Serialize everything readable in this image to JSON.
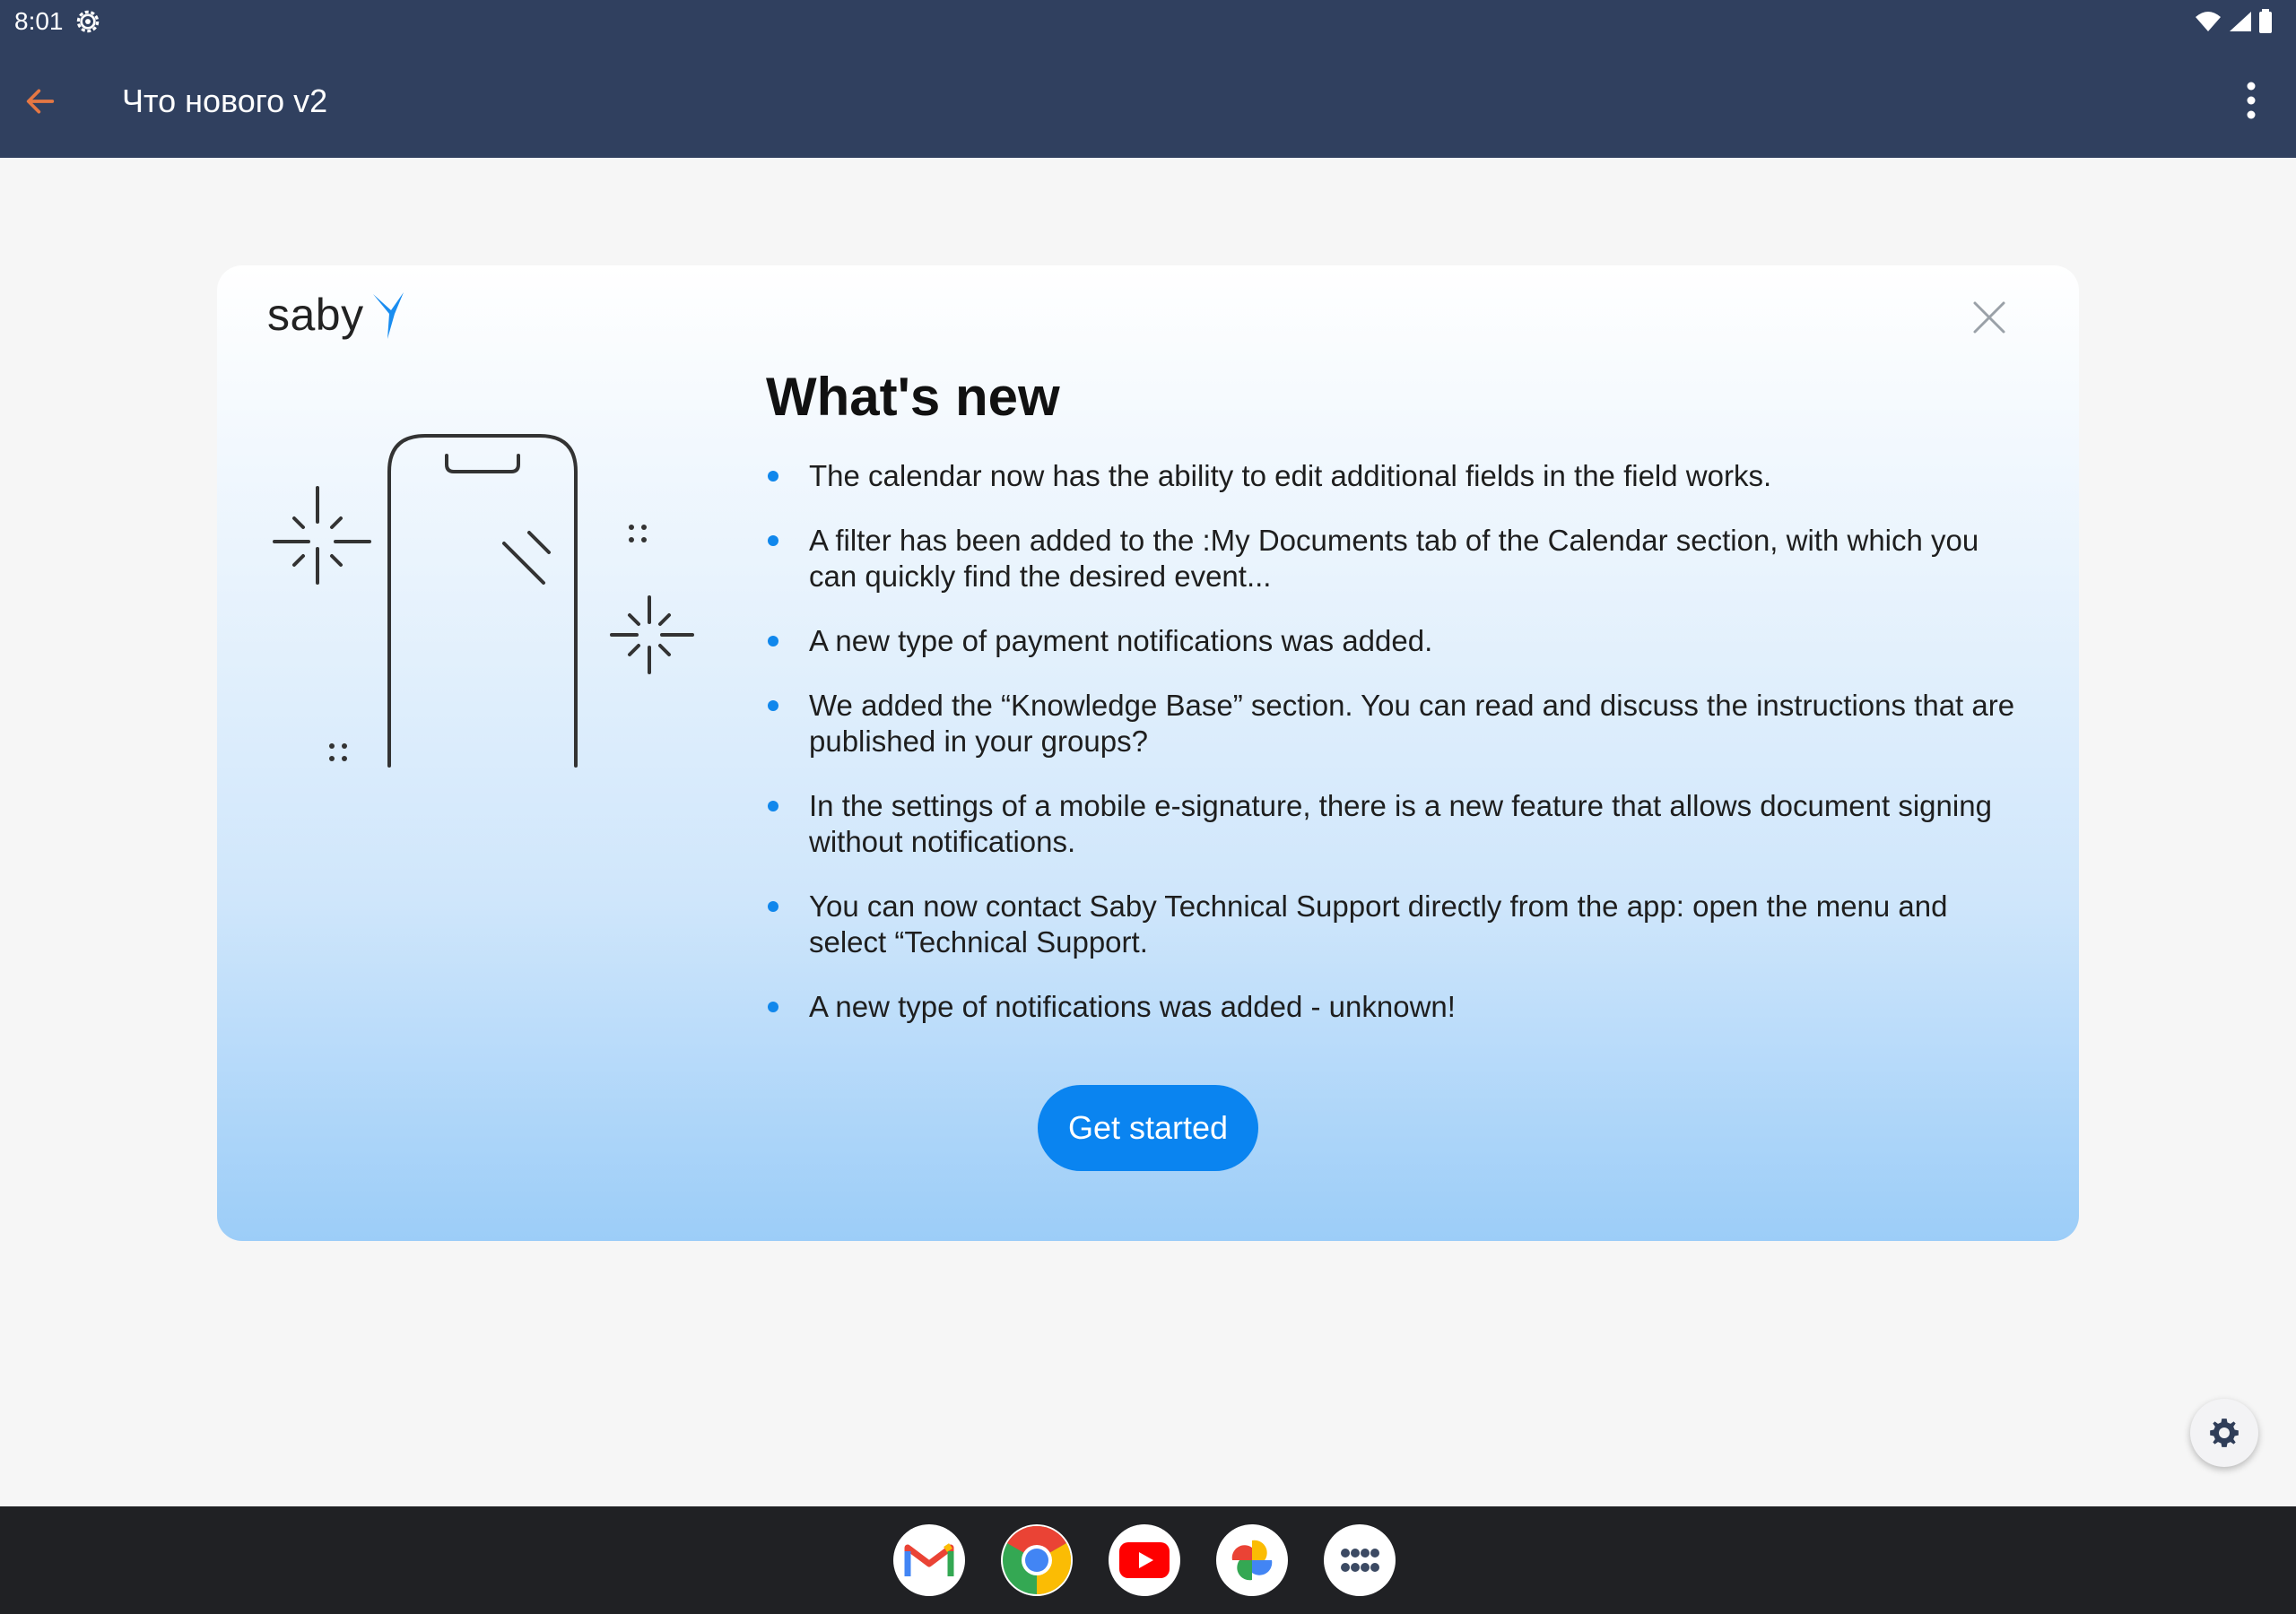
{
  "status_bar": {
    "time": "8:01",
    "icons": [
      "settings-icon",
      "wifi-icon",
      "signal-icon",
      "battery-icon"
    ]
  },
  "app_bar": {
    "title": "Что нового v2",
    "back_icon": "arrow-left-icon",
    "menu_icon": "more-vertical-icon",
    "accent_color": "#e57743",
    "background_color": "#30405f"
  },
  "card": {
    "logo_text": "saby",
    "heading": "What's new",
    "items": [
      "The calendar now has the ability to edit additional fields in the field works.",
      "A filter has been added to the :My Documents tab of the Calendar section, with which you can quickly find the desired event...",
      "A new type of payment notifications was added.",
      "We added the “Knowledge Base” section. You can read and discuss the instructions that are published in your groups?",
      "In the settings of a mobile e-signature, there is a new feature that allows document signing without notifications.",
      "You can now contact Saby Technical Support directly from the app: open the menu and select “Technical Support.",
      "A new type of notifications was added - unknown!"
    ],
    "button_label": "Get started",
    "button_color": "#0a84f0",
    "bullet_color": "#1087ec"
  },
  "dock": {
    "apps": [
      "gmail-icon",
      "chrome-icon",
      "youtube-icon",
      "photos-icon",
      "app-drawer-icon"
    ]
  }
}
